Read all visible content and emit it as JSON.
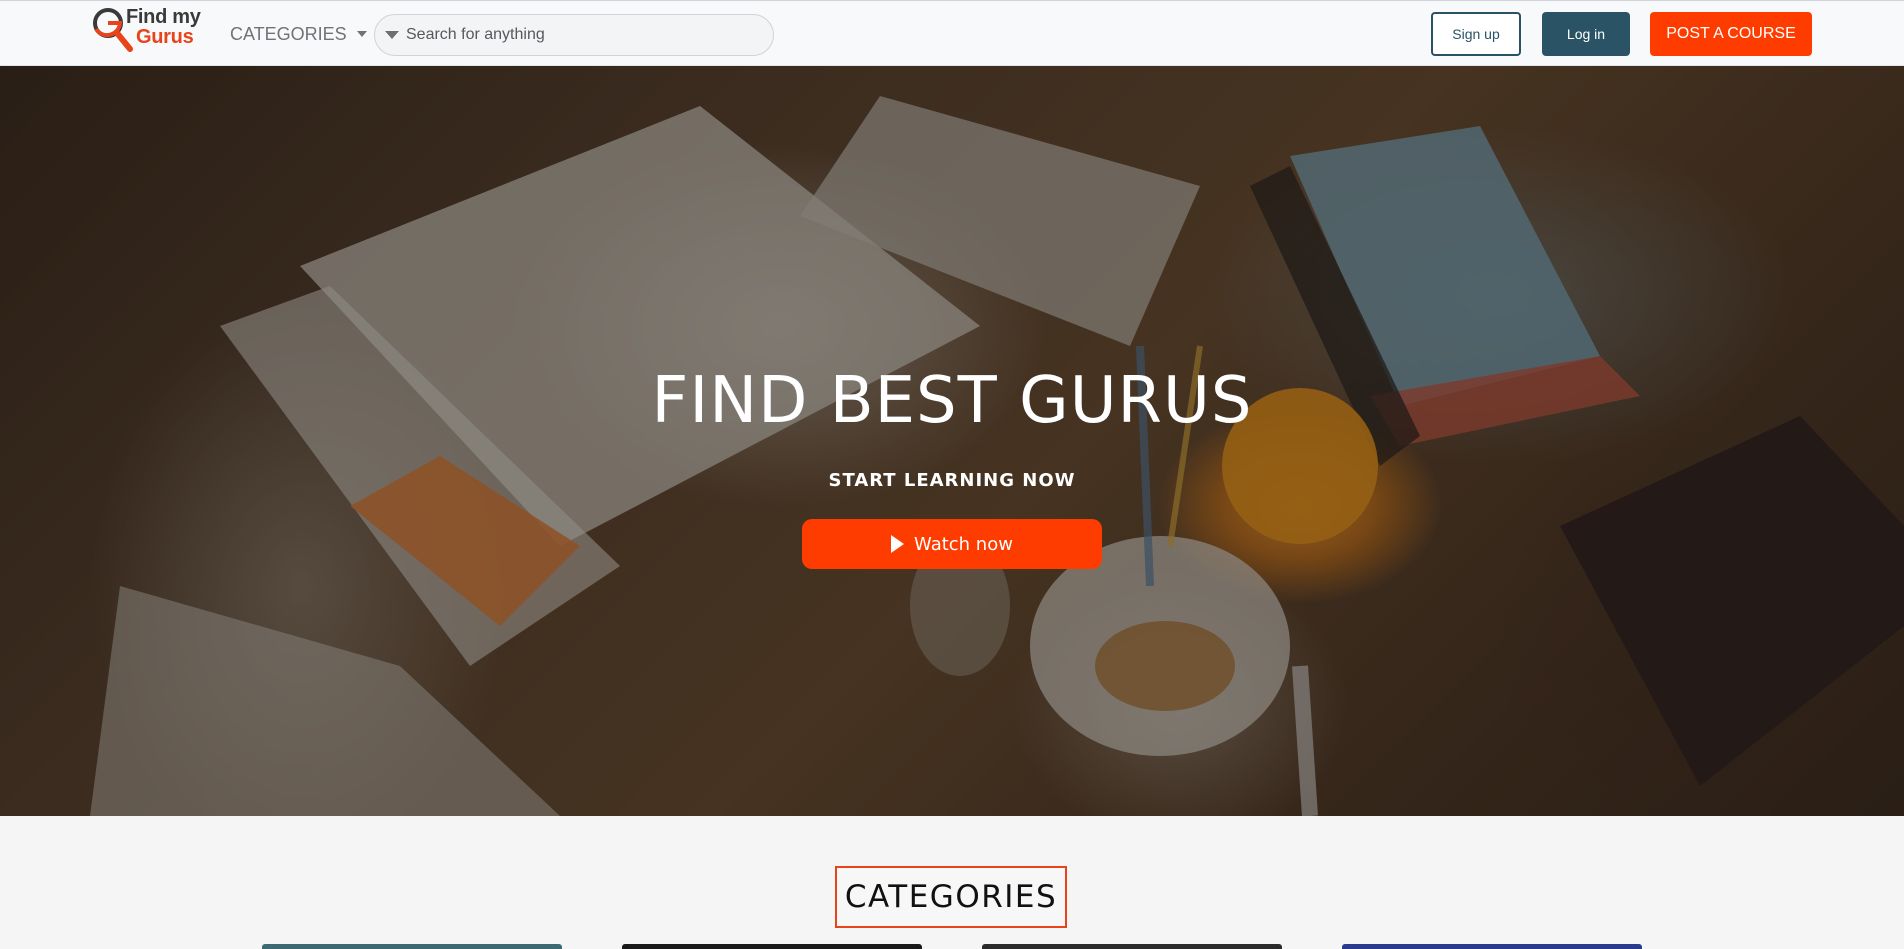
{
  "brand": {
    "line1": "Find my",
    "line2": "Gurus",
    "accent_color": "#e8431b",
    "dark_color": "#3a3a3a",
    "icon": "magnifier-g-logo-icon"
  },
  "nav": {
    "categories_label": "CATEGORIES",
    "categories_icon": "caret-down-icon",
    "search_placeholder": "Search for anything",
    "search_icon": "dropdown-triangle-icon",
    "signup_label": "Sign up",
    "login_label": "Log in",
    "post_course_label": "POST A COURSE"
  },
  "hero": {
    "title": "FIND BEST GURUS",
    "subtitle": "START LEARNING NOW",
    "watch_label": "Watch now",
    "watch_icon": "play-icon",
    "background": "study-desk-photo"
  },
  "categories": {
    "heading": "CATEGORIES"
  },
  "colors": {
    "primary_orange": "#ff3c00",
    "navy": "#2a5466",
    "navbar_bg": "#f8f9fa"
  }
}
